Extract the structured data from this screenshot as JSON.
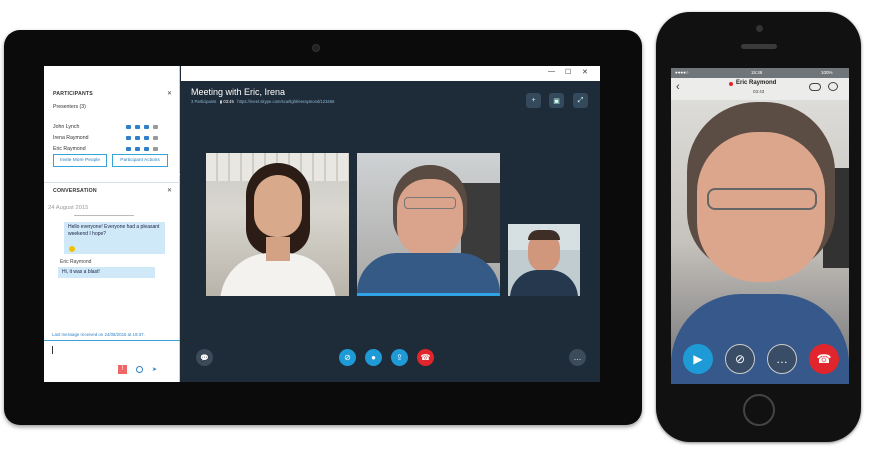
{
  "participants": {
    "section_title": "PARTICIPANTS",
    "presenters_label": "Presenters (3)",
    "people": [
      {
        "name": "John Lynch"
      },
      {
        "name": "Irena Raymond"
      },
      {
        "name": "Eric Raymond"
      }
    ],
    "invite_label": "Invite More People",
    "actions_label": "Participant Actions"
  },
  "conversation": {
    "section_title": "CONVERSATION",
    "date": "24 August 2015",
    "messages": [
      {
        "text": "Hello everyone! Everyone had a pleasant weekend I hope?"
      },
      {
        "author": "Eric Raymond",
        "text": "Hi, it was a blast!"
      }
    ],
    "status": "Last message received on 24/08/2015 at 19:37."
  },
  "meeting": {
    "title": "Meeting with Eric, Irena",
    "participants_count": "3 Participants",
    "duration": "03:45",
    "link": "https://meet.skype.com/scarlight/eeraymond/123456"
  },
  "window_controls": {
    "minimize": "—",
    "maximize": "☐",
    "close": "✕"
  },
  "phone": {
    "time": "15:38",
    "battery": "100%",
    "caller_name": "Eric Raymond",
    "call_duration": "03:43"
  },
  "colors": {
    "accent": "#1e9ad6",
    "hangup": "#e0262c",
    "call_bg": "#1e2b38"
  }
}
